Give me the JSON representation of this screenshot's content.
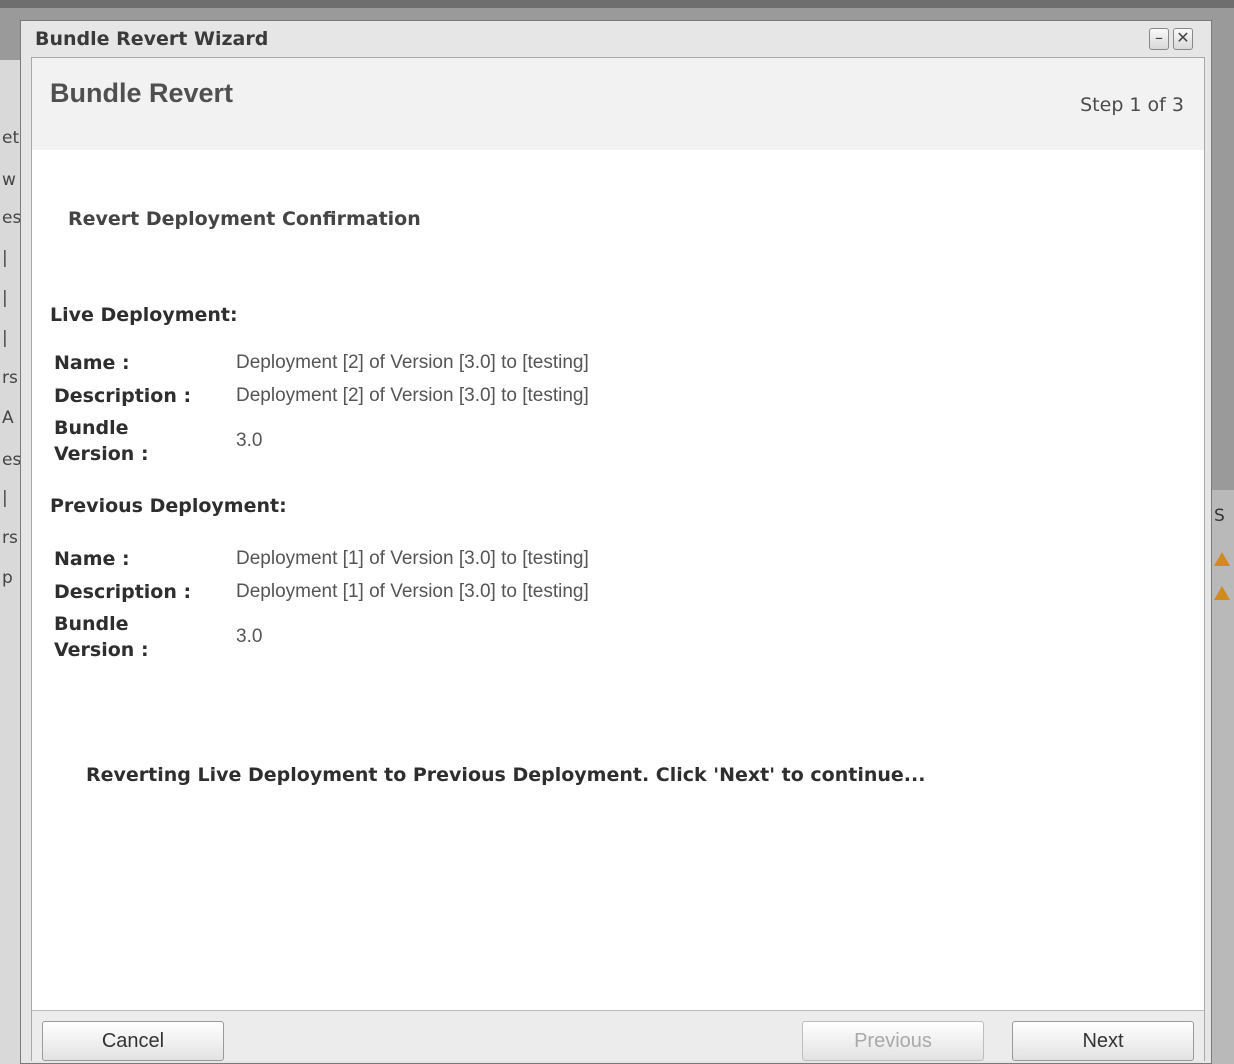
{
  "window": {
    "title": "Bundle Revert Wizard",
    "minimize_glyph": "–",
    "close_glyph": "✕"
  },
  "header": {
    "title": "Bundle Revert",
    "step": "Step 1 of 3"
  },
  "confirmation_title": "Revert Deployment Confirmation",
  "live": {
    "section_title": "Live Deployment:",
    "name_label": "Name :",
    "name_value": "Deployment [2] of Version [3.0] to [testing]",
    "description_label": "Description :",
    "description_value": "Deployment [2] of Version [3.0] to [testing]",
    "bundle_label_1": "Bundle",
    "bundle_label_2": "Version :",
    "bundle_value": "3.0"
  },
  "previous": {
    "section_title": "Previous Deployment:",
    "name_label": "Name :",
    "name_value": "Deployment [1] of Version [3.0] to [testing]",
    "description_label": "Description :",
    "description_value": "Deployment [1] of Version [3.0] to [testing]",
    "bundle_label_1": "Bundle",
    "bundle_label_2": "Version :",
    "bundle_value": "3.0"
  },
  "notice": "Reverting Live Deployment to Previous Deployment. Click 'Next' to continue...",
  "buttons": {
    "cancel": "Cancel",
    "previous": "Previous",
    "next": "Next"
  },
  "background": {
    "left_fragments": [
      "et",
      "w",
      "es",
      "|",
      "|",
      "|",
      "rs",
      "A",
      "es",
      "|",
      "rs",
      "p"
    ],
    "right_header": "S"
  }
}
